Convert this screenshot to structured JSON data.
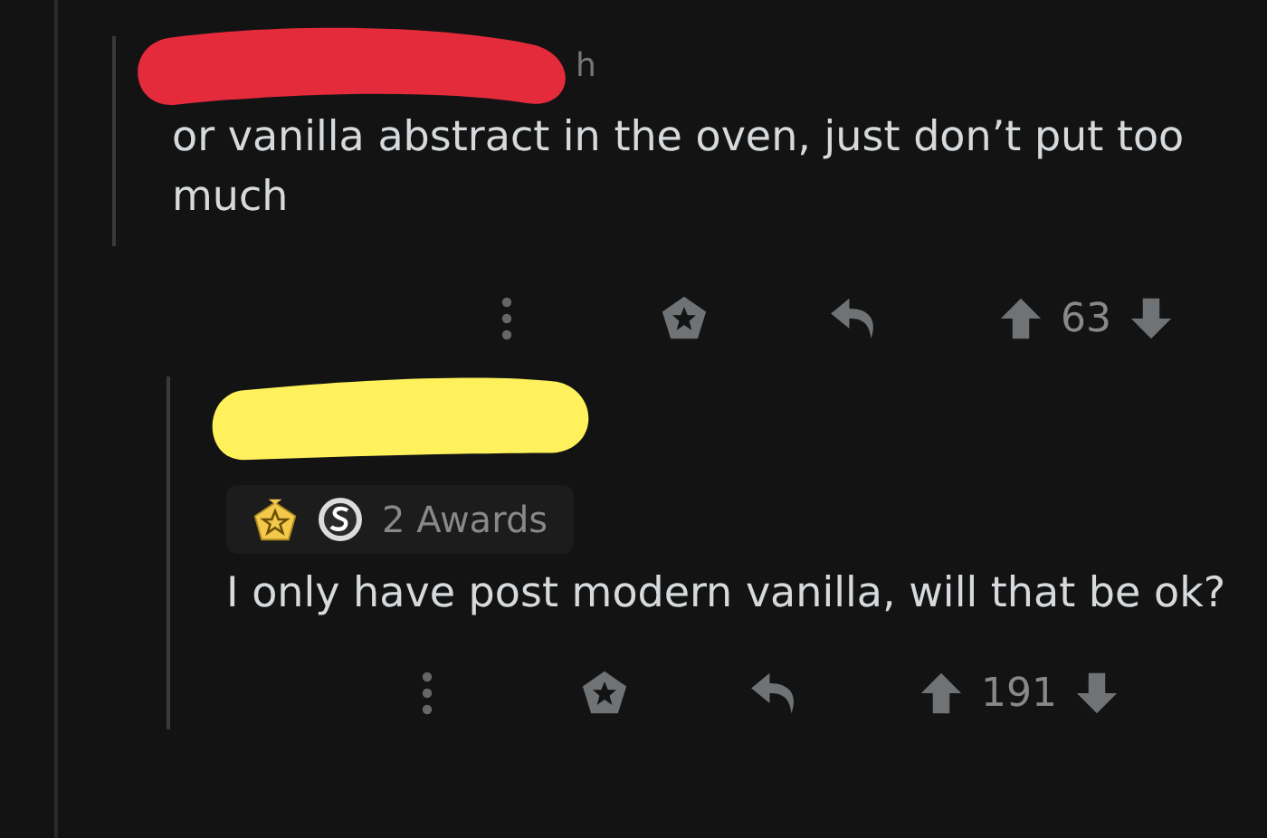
{
  "comments": [
    {
      "author_redaction": {
        "color": "#e32b3c"
      },
      "timestamp": "h",
      "body": "or vanilla abstract in the oven, just don’t put too much",
      "score": "63",
      "children": [
        {
          "author_redaction": {
            "color": "#fff15c"
          },
          "awards": {
            "label": "2 Awards"
          },
          "body": "I only have post modern vanilla, will that be ok?",
          "score": "191"
        }
      ]
    }
  ]
}
